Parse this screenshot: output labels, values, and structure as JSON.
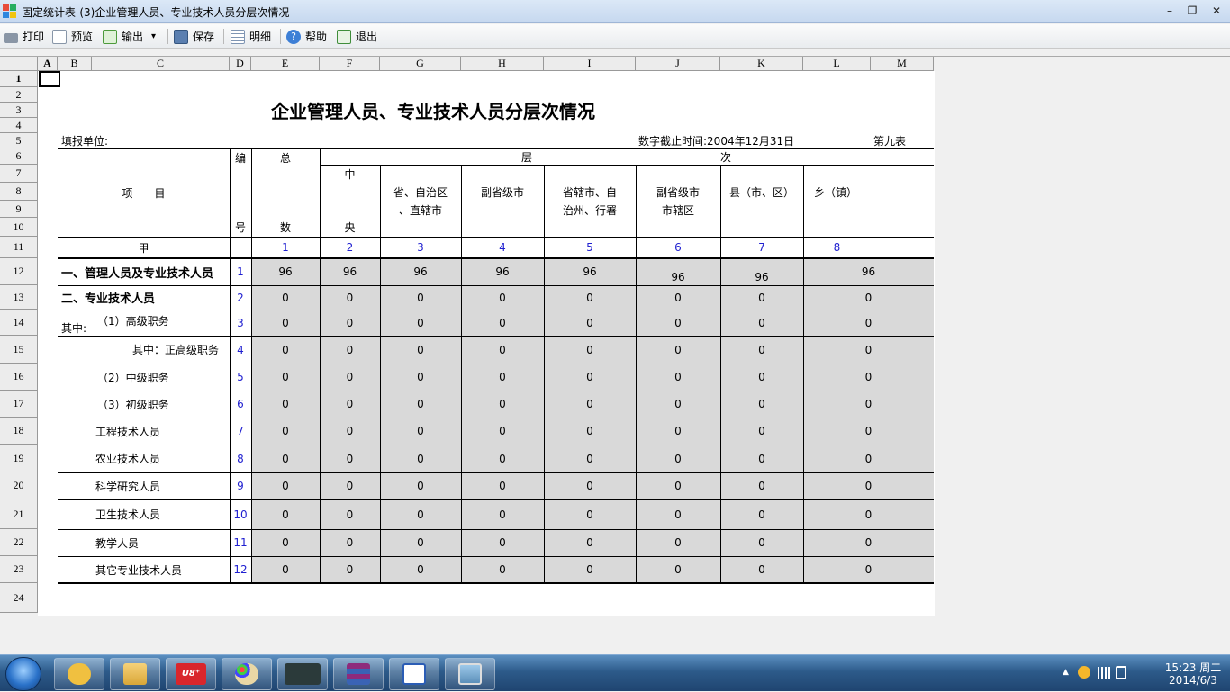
{
  "window": {
    "title": "固定统计表-(3)企业管理人员、专业技术人员分层次情况",
    "minimize": "–",
    "restore": "❐",
    "close": "✕"
  },
  "toolbar": {
    "print": "打印",
    "preview": "预览",
    "export": "输出",
    "export_arrow": "▾",
    "save": "保存",
    "detail": "明细",
    "help": "帮助",
    "exit": "退出"
  },
  "columns": [
    "A",
    "B",
    "C",
    "D",
    "E",
    "F",
    "G",
    "H",
    "I",
    "J",
    "K",
    "L",
    "M"
  ],
  "rows": [
    "1",
    "2",
    "3",
    "4",
    "5",
    "6",
    "7",
    "8",
    "9",
    "10",
    "11",
    "12",
    "13",
    "14",
    "15",
    "16",
    "17",
    "18",
    "19",
    "20",
    "21",
    "22",
    "23",
    "24"
  ],
  "report": {
    "title": "企业管理人员、专业技术人员分层次情况",
    "unit_label": "填报单位:",
    "date_label": "数字截止时间:2004年12月31日",
    "table_no": "第九表",
    "headers": {
      "item": "项　　目",
      "code_top": "编",
      "code_bottom": "号",
      "total_top": "总",
      "total_bottom": "数",
      "level_left": "层",
      "level_right": "次",
      "central_top": "中",
      "central_bottom": "央",
      "province_line1": "省、自治区",
      "province_line2": "、直辖市",
      "sub_province": "副省级市",
      "prefecture_line1": "省辖市、自",
      "prefecture_line2": "治州、行署",
      "sub_province_district_line1": "副省级市",
      "sub_province_district_line2": "市辖区",
      "county": "县（市、区）",
      "township": "乡（镇）",
      "col_jia": "甲",
      "col_nums": [
        "1",
        "2",
        "3",
        "4",
        "5",
        "6",
        "7",
        "8"
      ]
    },
    "data_rows": [
      {
        "label": "一、管理人员及专业技术人员",
        "code": "1",
        "values": [
          "96",
          "96",
          "96",
          "96",
          "96",
          "96",
          "96",
          "96"
        ]
      },
      {
        "label": "二、专业技术人员",
        "code": "2",
        "values": [
          "0",
          "0",
          "0",
          "0",
          "0",
          "0",
          "0",
          "0"
        ]
      },
      {
        "label_prefix": "其中:",
        "label": "（1）高级职务",
        "code": "3",
        "values": [
          "0",
          "0",
          "0",
          "0",
          "0",
          "0",
          "0",
          "0"
        ]
      },
      {
        "label": "其中：正高级职务",
        "code": "4",
        "values": [
          "0",
          "0",
          "0",
          "0",
          "0",
          "0",
          "0",
          "0"
        ]
      },
      {
        "label": "（2）中级职务",
        "code": "5",
        "values": [
          "0",
          "0",
          "0",
          "0",
          "0",
          "0",
          "0",
          "0"
        ]
      },
      {
        "label": "（3）初级职务",
        "code": "6",
        "values": [
          "0",
          "0",
          "0",
          "0",
          "0",
          "0",
          "0",
          "0"
        ]
      },
      {
        "label": "工程技术人员",
        "code": "7",
        "values": [
          "0",
          "0",
          "0",
          "0",
          "0",
          "0",
          "0",
          "0"
        ]
      },
      {
        "label": "农业技术人员",
        "code": "8",
        "values": [
          "0",
          "0",
          "0",
          "0",
          "0",
          "0",
          "0",
          "0"
        ]
      },
      {
        "label": "科学研究人员",
        "code": "9",
        "values": [
          "0",
          "0",
          "0",
          "0",
          "0",
          "0",
          "0",
          "0"
        ]
      },
      {
        "label": "卫生技术人员",
        "code": "10",
        "values": [
          "0",
          "0",
          "0",
          "0",
          "0",
          "0",
          "0",
          "0"
        ]
      },
      {
        "label": "教学人员",
        "code": "11",
        "values": [
          "0",
          "0",
          "0",
          "0",
          "0",
          "0",
          "0",
          "0"
        ]
      },
      {
        "label": "其它专业技术人员",
        "code": "12",
        "values": [
          "0",
          "0",
          "0",
          "0",
          "0",
          "0",
          "0",
          "0"
        ]
      }
    ]
  },
  "taskbar": {
    "apps": [
      "start-orb",
      "outlook-icon",
      "explorer-icon",
      "u8-icon",
      "paint-icon",
      "media-icon",
      "winrar-icon",
      "word-icon",
      "photo-icon"
    ],
    "u8_label": "U8⁺",
    "tray_arrow": "▲",
    "time": "15:23 周二",
    "date": "2014/6/3"
  },
  "colors": {
    "accent_blue": "#1f1fd0",
    "gray_fill": "#d9d9d9"
  }
}
